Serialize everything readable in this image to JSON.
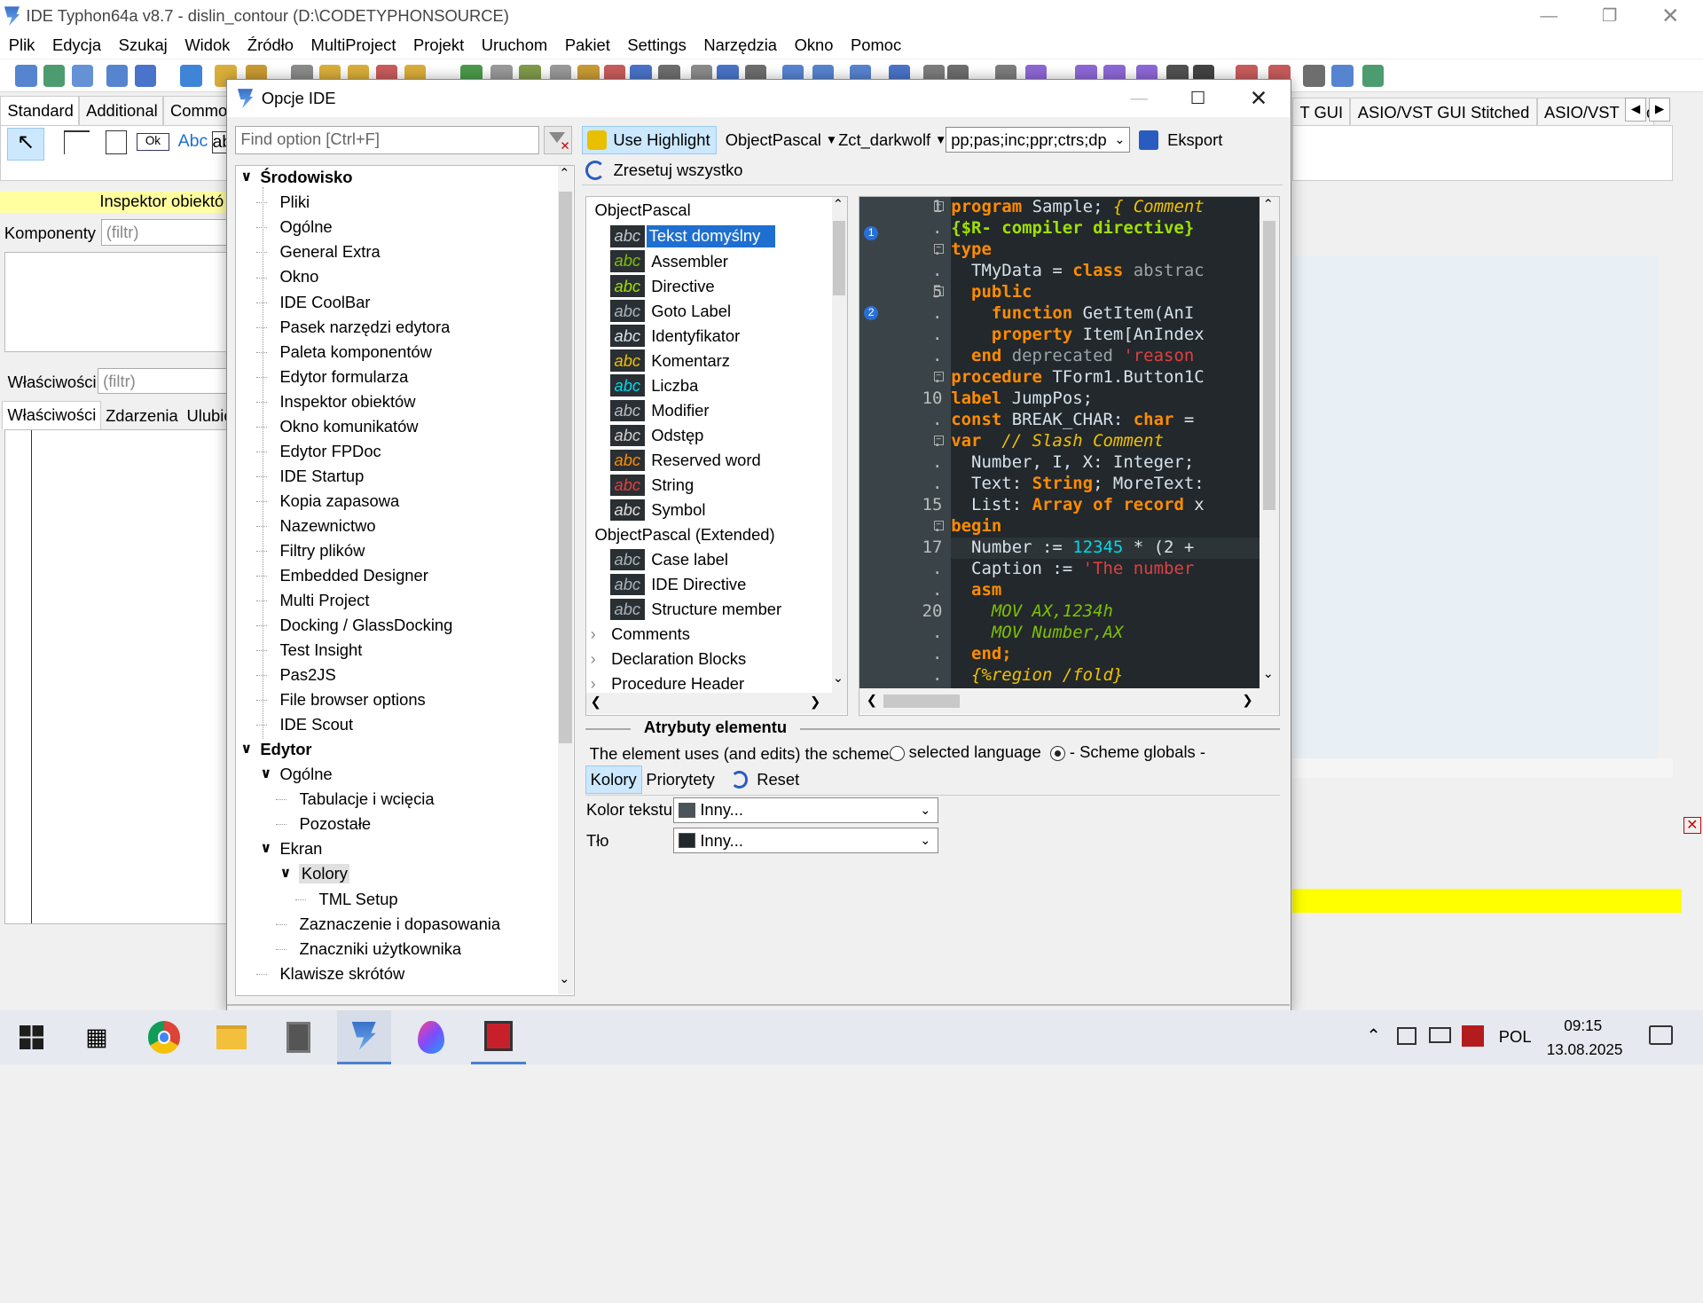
{
  "window": {
    "title": "IDE Typhon64a v8.7 - dislin_contour (D:\\CODETYPHONSOURCE)"
  },
  "menu": [
    "Plik",
    "Edycja",
    "Szukaj",
    "Widok",
    "Źródło",
    "MultiProject",
    "Projekt",
    "Uruchom",
    "Pakiet",
    "Settings",
    "Narzędzia",
    "Okno",
    "Pomoc"
  ],
  "palette_tabs": [
    "Standard",
    "Additional",
    "Commo"
  ],
  "right_tabs": [
    "T GUI",
    "ASIO/VST GUI Stitched",
    "ASIO/VST Modu"
  ],
  "palette_items": {
    "ok": "Ok",
    "abc": "Abc",
    "ab": "ab"
  },
  "inspector": {
    "title": "Inspektor obiektó",
    "components_label": "Komponenty",
    "filter": "(filtr)",
    "properties_label": "Właściwości",
    "tabs": [
      "Właściwości",
      "Zdarzenia",
      "Ulubio"
    ]
  },
  "dialog": {
    "title": "Opcje IDE",
    "find_placeholder": "Find option [Ctrl+F]",
    "tree": [
      {
        "label": "Środowisko",
        "level": 0,
        "bold": true,
        "expanded": true
      },
      {
        "label": "Pliki",
        "level": 1
      },
      {
        "label": "Ogólne",
        "level": 1
      },
      {
        "label": "General Extra",
        "level": 1
      },
      {
        "label": "Okno",
        "level": 1
      },
      {
        "label": "IDE CoolBar",
        "level": 1
      },
      {
        "label": "Pasek narzędzi edytora",
        "level": 1
      },
      {
        "label": "Paleta komponentów",
        "level": 1
      },
      {
        "label": "Edytor formularza",
        "level": 1
      },
      {
        "label": "Inspektor obiektów",
        "level": 1
      },
      {
        "label": "Okno komunikatów",
        "level": 1
      },
      {
        "label": "Edytor FPDoc",
        "level": 1
      },
      {
        "label": "IDE Startup",
        "level": 1
      },
      {
        "label": "Kopia zapasowa",
        "level": 1
      },
      {
        "label": "Nazewnictwo",
        "level": 1
      },
      {
        "label": "Filtry plików",
        "level": 1
      },
      {
        "label": "Embedded Designer",
        "level": 1
      },
      {
        "label": "Multi Project",
        "level": 1
      },
      {
        "label": "Docking / GlassDocking",
        "level": 1
      },
      {
        "label": "Test Insight",
        "level": 1
      },
      {
        "label": "Pas2JS",
        "level": 1
      },
      {
        "label": "File browser options",
        "level": 1
      },
      {
        "label": "IDE Scout",
        "level": 1
      },
      {
        "label": "Edytor",
        "level": 0,
        "bold": true,
        "expanded": true
      },
      {
        "label": "Ogólne",
        "level": 1,
        "expanded": true
      },
      {
        "label": "Tabulacje i wcięcia",
        "level": 2
      },
      {
        "label": "Pozostałe",
        "level": 2
      },
      {
        "label": "Ekran",
        "level": 1,
        "expanded": true
      },
      {
        "label": "Kolory",
        "level": 2,
        "expanded": true,
        "selected": true
      },
      {
        "label": "TML Setup",
        "level": 3
      },
      {
        "label": "Zaznaczenie i dopasowania",
        "level": 2
      },
      {
        "label": "Znaczniki użytkownika",
        "level": 2
      },
      {
        "label": "Klawisze skrótów",
        "level": 1
      }
    ],
    "toolbar": {
      "use_highlight": "Use Highlight",
      "language": "ObjectPascal",
      "scheme": "Zct_darkwolf",
      "extensions": "pp;pas;inc;ppr;ctrs;dp",
      "export": "Eksport",
      "reset_all": "Zresetuj wszystko"
    },
    "attributes": {
      "group1": "ObjectPascal",
      "items1": [
        {
          "label": "Tekst domyślny",
          "fg": "#c0c8cc",
          "selected": true
        },
        {
          "label": "Assembler",
          "fg": "#7ec000"
        },
        {
          "label": "Directive",
          "fg": "#a0e000"
        },
        {
          "label": "Goto Label",
          "fg": "#aab4ba"
        },
        {
          "label": "Identyfikator",
          "fg": "#d6e2ea"
        },
        {
          "label": "Komentarz",
          "fg": "#f0c000"
        },
        {
          "label": "Liczba",
          "fg": "#00d8e8"
        },
        {
          "label": "Modifier",
          "fg": "#b6bec4"
        },
        {
          "label": "Odstęp",
          "fg": "#d0d0d0"
        },
        {
          "label": "Reserved word",
          "fg": "#ff8c00"
        },
        {
          "label": "String",
          "fg": "#e04040"
        },
        {
          "label": "Symbol",
          "fg": "#e0e0e0"
        }
      ],
      "group2": "ObjectPascal (Extended)",
      "items2": [
        {
          "label": "Case label",
          "fg": "#aab4ba"
        },
        {
          "label": "IDE Directive",
          "fg": "#aab4ba"
        },
        {
          "label": "Structure member",
          "fg": "#aab4ba"
        }
      ],
      "collapsed": [
        "Comments",
        "Declaration Blocks",
        "Procedure Header"
      ]
    },
    "code": {
      "line_numbers": [
        "1",
        ".",
        ".",
        ".",
        "5",
        ".",
        ".",
        ".",
        ".",
        "10",
        ".",
        ".",
        ".",
        ".",
        "15",
        ".",
        "17",
        ".",
        ".",
        "20",
        ".",
        ".",
        "."
      ],
      "lines": [
        [
          [
            "program ",
            "#ff8c00"
          ],
          [
            "Sample; ",
            "#d6e2ea"
          ],
          [
            "{ Comment",
            "#f0c000"
          ]
        ],
        [
          [
            "{$R- compiler directive}",
            "#a0e000"
          ]
        ],
        [
          [
            "type",
            "#ff8c00"
          ]
        ],
        [
          [
            "  TMyData = ",
            "#d6e2ea"
          ],
          [
            "class ",
            "#ff8c00"
          ],
          [
            "abstrac",
            "#9aa4aa"
          ]
        ],
        [
          [
            "  public",
            "#ff8c00"
          ]
        ],
        [
          [
            "    function ",
            "#ff8c00"
          ],
          [
            "GetItem(AnI",
            "#d6e2ea"
          ]
        ],
        [
          [
            "    property ",
            "#ff8c00"
          ],
          [
            "Item[AnIndex",
            "#d6e2ea"
          ]
        ],
        [
          [
            "  end ",
            "#ff8c00"
          ],
          [
            "deprecated ",
            "#9aa4aa"
          ],
          [
            "'reason",
            "#e04040"
          ]
        ],
        [
          [
            "procedure ",
            "#ff8c00"
          ],
          [
            "TForm1.Button1C",
            "#d6e2ea"
          ]
        ],
        [
          [
            "label ",
            "#ff8c00"
          ],
          [
            "JumpPos;",
            "#d6e2ea"
          ]
        ],
        [
          [
            "const ",
            "#ff8c00"
          ],
          [
            "BREAK_CHAR: ",
            "#d6e2ea"
          ],
          [
            "char ",
            "#ff8c00"
          ],
          [
            "=",
            "#d6e2ea"
          ]
        ],
        [
          [
            "var ",
            "#ff8c00"
          ],
          [
            " // Slash Comment",
            "#f0c000"
          ]
        ],
        [
          [
            "  Number, I, X: Integer;",
            "#d6e2ea"
          ]
        ],
        [
          [
            "  Text: ",
            "#d6e2ea"
          ],
          [
            "String",
            "#ff8c00"
          ],
          [
            "; MoreText:",
            "#d6e2ea"
          ]
        ],
        [
          [
            "  List: ",
            "#d6e2ea"
          ],
          [
            "Array of record ",
            "#ff8c00"
          ],
          [
            "x",
            "#d6e2ea"
          ]
        ],
        [
          [
            "begin",
            "#ff8c00"
          ]
        ],
        [
          [
            "  Number := ",
            "#d6e2ea"
          ],
          [
            "12345",
            "#00d8e8"
          ],
          [
            " * (2 +",
            "#d6e2ea"
          ]
        ],
        [
          [
            "  Caption := ",
            "#d6e2ea"
          ],
          [
            "'The number",
            "#e04040"
          ]
        ],
        [
          [
            "  asm",
            "#ff8c00"
          ]
        ],
        [
          [
            "    MOV AX,1234h",
            "#7ec000"
          ]
        ],
        [
          [
            "    MOV Number,AX",
            "#7ec000"
          ]
        ],
        [
          [
            "  end;",
            "#ff8c00"
          ]
        ],
        [
          [
            "  {%region /fold}",
            "#f0c000"
          ]
        ]
      ],
      "fold_marker": "..."
    },
    "attr_section": {
      "title": "Atrybuty elementu",
      "scheme_text": "The element uses (and edits) the schemes:",
      "opt1": "selected language",
      "opt2": "- Scheme globals -",
      "tabs": [
        "Kolory",
        "Priorytety"
      ],
      "reset": "Reset",
      "fg_label": "Kolor tekstu",
      "bg_label": "Tło",
      "fg_value": "Inny...",
      "bg_value": "Inny...",
      "fg_swatch": "#4a545a",
      "bg_swatch": "#22282c"
    }
  },
  "taskbar": {
    "lang": "POL",
    "time": "09:15",
    "date": "13.08.2025"
  }
}
